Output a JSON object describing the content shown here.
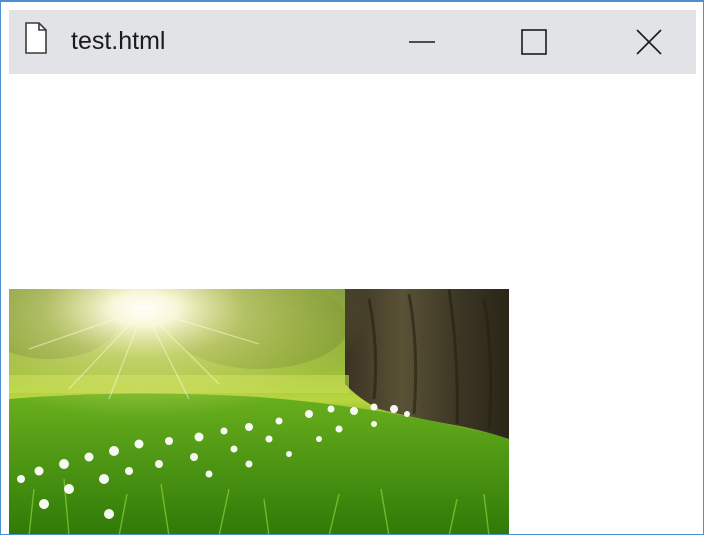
{
  "window": {
    "title": "test.html",
    "controls": {
      "minimize_icon": "minimize-icon",
      "maximize_icon": "maximize-icon",
      "close_icon": "close-icon"
    },
    "file_icon": "document-icon"
  },
  "content": {
    "image": {
      "description_icon": "nature-photo"
    }
  },
  "colors": {
    "titlebar_bg": "#e1e3e6",
    "window_border": "#4d8fcf",
    "content_bg": "#ffffff"
  }
}
